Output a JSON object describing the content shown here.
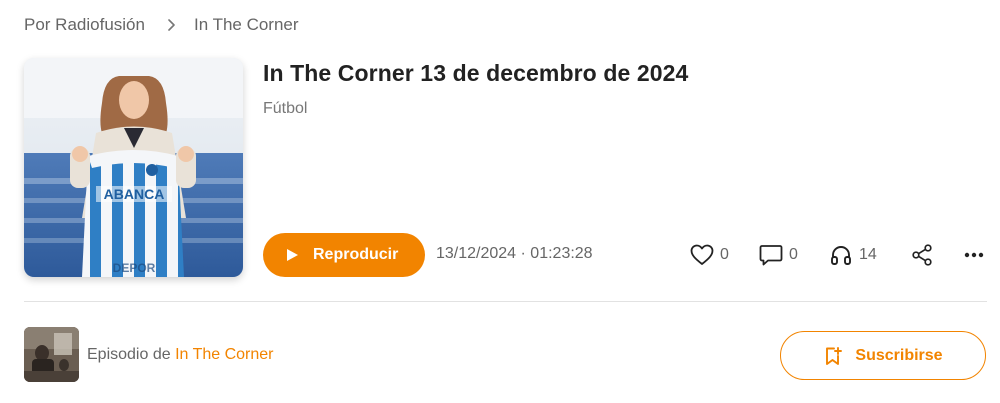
{
  "breadcrumb": {
    "items": [
      {
        "label": "Por Radiofusión"
      },
      {
        "label": "In The Corner"
      }
    ]
  },
  "episode": {
    "title": "In The Corner 13 de decembro de 2024",
    "category": "Fútbol",
    "date_duration": "13/12/2024 · 01:23:28",
    "cover_jersey_text": "ABANCA",
    "cover_banner_text": "DEPOR"
  },
  "actions": {
    "play_label": "Reproducir",
    "likes": "0",
    "comments": "0",
    "listens": "14",
    "share_icon": "share-icon",
    "more_icon": "more-icon"
  },
  "footer": {
    "episode_of_prefix": "Episodio de",
    "podcast_name": "In The Corner",
    "subscribe_label": "Suscribirse"
  },
  "colors": {
    "accent": "#f28400",
    "text_primary": "#222222",
    "text_muted": "#666666",
    "divider": "#e2e2e2"
  }
}
